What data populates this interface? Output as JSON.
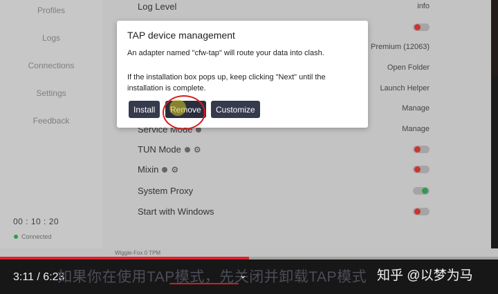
{
  "sidebar": {
    "items": [
      {
        "label": "Profiles"
      },
      {
        "label": "Logs"
      },
      {
        "label": "Connections"
      },
      {
        "label": "Settings"
      },
      {
        "label": "Feedback"
      }
    ],
    "clock": "00 : 10 : 20",
    "status": "Connected"
  },
  "settings": {
    "log_level": {
      "label": "Log Level",
      "value": "info"
    },
    "premium": "Premium (12063)",
    "open_folder": "Open Folder",
    "launch_helper": "Launch Helper",
    "manage_1": "Manage",
    "service_mode": {
      "label": "Service Mode",
      "value": "Manage"
    },
    "tun_mode": {
      "label": "TUN Mode",
      "state": "off"
    },
    "mixin": {
      "label": "Mixin",
      "state": "off"
    },
    "system_proxy": {
      "label": "System Proxy",
      "state": "on"
    },
    "start_with_windows": {
      "label": "Start with Windows",
      "state": "off"
    },
    "footer_text": "Wiggle-Fox 0 TPM"
  },
  "dialog": {
    "title": "TAP device management",
    "line1": "An adapter named \"cfw-tap\" will route your data into clash.",
    "line2": "If the installation box pops up, keep clicking \"Next\" until the installation is complete.",
    "buttons": {
      "install": "Install",
      "remove": "Remove",
      "customize": "Customize"
    }
  },
  "player": {
    "time": "3:11 / 6:23",
    "progress_fraction": 0.5,
    "subtitle": "如果你在使用TAP模式，先关闭并卸载TAP模式",
    "watermark": "知乎 @以梦为马"
  },
  "colors": {
    "accent_red": "#e0212f",
    "button": "#363a4d",
    "toggle_on": "#2e9a4e",
    "toggle_off": "#cc3333"
  }
}
